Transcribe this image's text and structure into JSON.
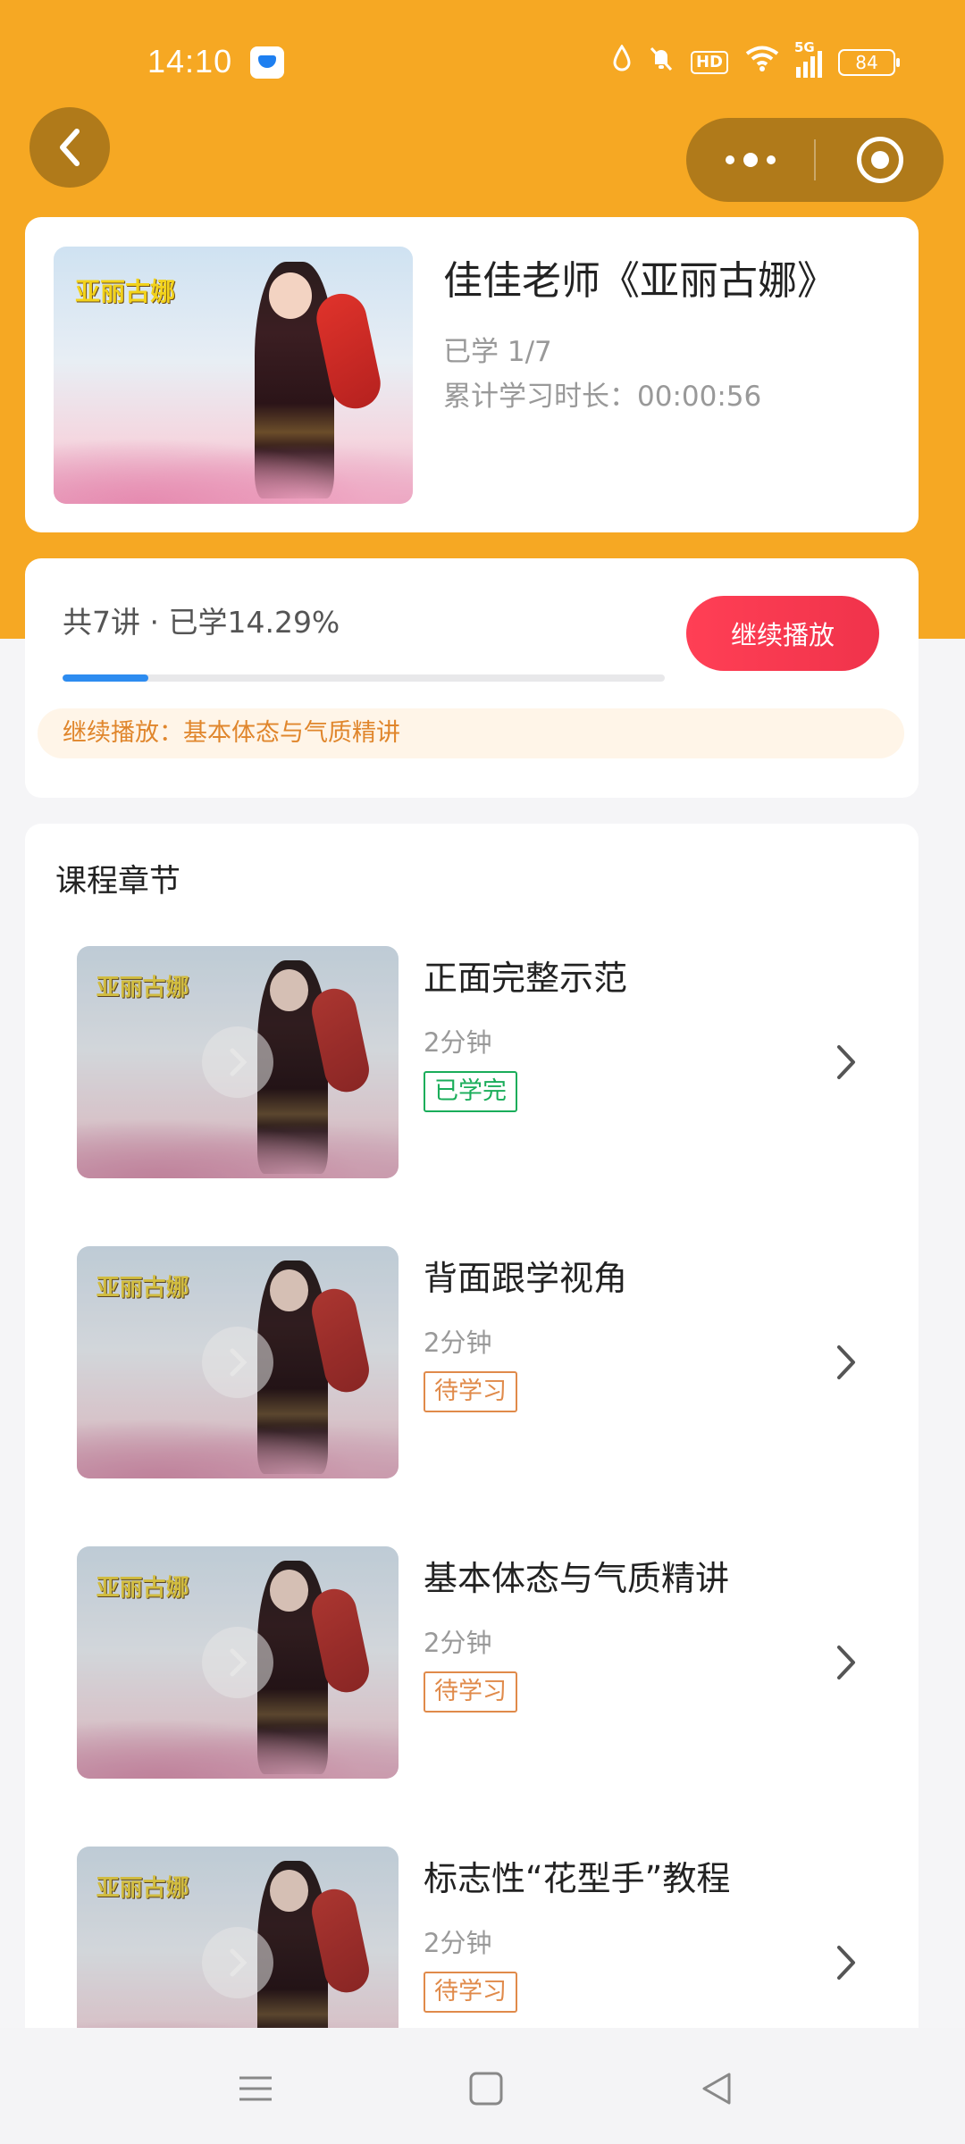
{
  "status_bar": {
    "time": "14:10",
    "network": "5G",
    "battery": "84",
    "icons": [
      "water-drop-icon",
      "bell-muted-icon",
      "hd-icon",
      "wifi-icon",
      "signal-icon"
    ]
  },
  "nav": {
    "back_icon": "chevron-left-icon",
    "more_icon": "more-dots-icon",
    "close_icon": "target-close-icon"
  },
  "course": {
    "thumb_art_title": "亚丽古娜",
    "title": "佳佳老师《亚丽古娜》",
    "learned": "已学 1/7",
    "duration": "累计学习时长：00:00:56"
  },
  "progress": {
    "summary": "共7讲 · 已学14.29%",
    "percent": 14.29,
    "continue_label": "继续播放",
    "resume_text": "继续播放：基本体态与气质精讲"
  },
  "chapters": {
    "heading": "课程章节",
    "items": [
      {
        "title": "正面完整示范",
        "duration": "2分钟",
        "status": "已学完",
        "done": true
      },
      {
        "title": "背面跟学视角",
        "duration": "2分钟",
        "status": "待学习",
        "done": false
      },
      {
        "title": "基本体态与气质精讲",
        "duration": "2分钟",
        "status": "待学习",
        "done": false
      },
      {
        "title": "标志性“花型手”教程",
        "duration": "2分钟",
        "status": "待学习",
        "done": false
      }
    ]
  },
  "colors": {
    "header_orange": "#f6a823",
    "accent_red": "#f0334b",
    "progress_blue": "#2d8cf0",
    "done_green": "#1aad5a",
    "todo_orange": "#e08a4a"
  }
}
